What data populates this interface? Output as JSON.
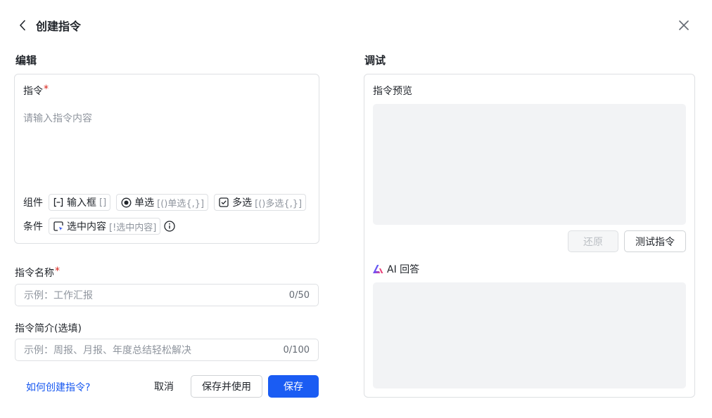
{
  "header": {
    "title": "创建指令",
    "back_icon": "chevron-left-icon",
    "close_icon": "close-icon"
  },
  "edit": {
    "section_title": "编辑",
    "instruction_label": "指令",
    "required_mark": "*",
    "instruction_placeholder": "请输入指令内容",
    "components_label": "组件",
    "components": [
      {
        "icon": "input-box-icon",
        "label": "输入框",
        "hint": "[]"
      },
      {
        "icon": "radio-icon",
        "label": "单选",
        "hint": "[()单选{,}]"
      },
      {
        "icon": "checkbox-icon",
        "label": "多选",
        "hint": "[()多选{,}]"
      }
    ],
    "conditions_label": "条件",
    "conditions": [
      {
        "icon": "selection-cursor-icon",
        "label": "选中内容",
        "hint": "[!选中内容]"
      }
    ],
    "info_icon": "info-icon",
    "name_label": "指令名称",
    "name_placeholder": "示例：工作汇报",
    "name_counter": "0/50",
    "desc_label": "指令简介(选填)",
    "desc_placeholder": "示例：周报、月报、年度总结轻松解决",
    "desc_counter": "0/100"
  },
  "footer": {
    "help_link": "如何创建指令?",
    "cancel_label": "取消",
    "save_use_label": "保存并使用",
    "save_label": "保存"
  },
  "debug": {
    "section_title": "调试",
    "preview_label": "指令预览",
    "restore_label": "还原",
    "test_label": "测试指令",
    "ai_label": "AI 回答",
    "ai_icon": "ai-logo-icon"
  },
  "colors": {
    "primary": "#1a5cf3",
    "required": "#d7231b",
    "link": "#1456f0",
    "placeholder": "#8f959e",
    "area": "#f2f3f5"
  }
}
